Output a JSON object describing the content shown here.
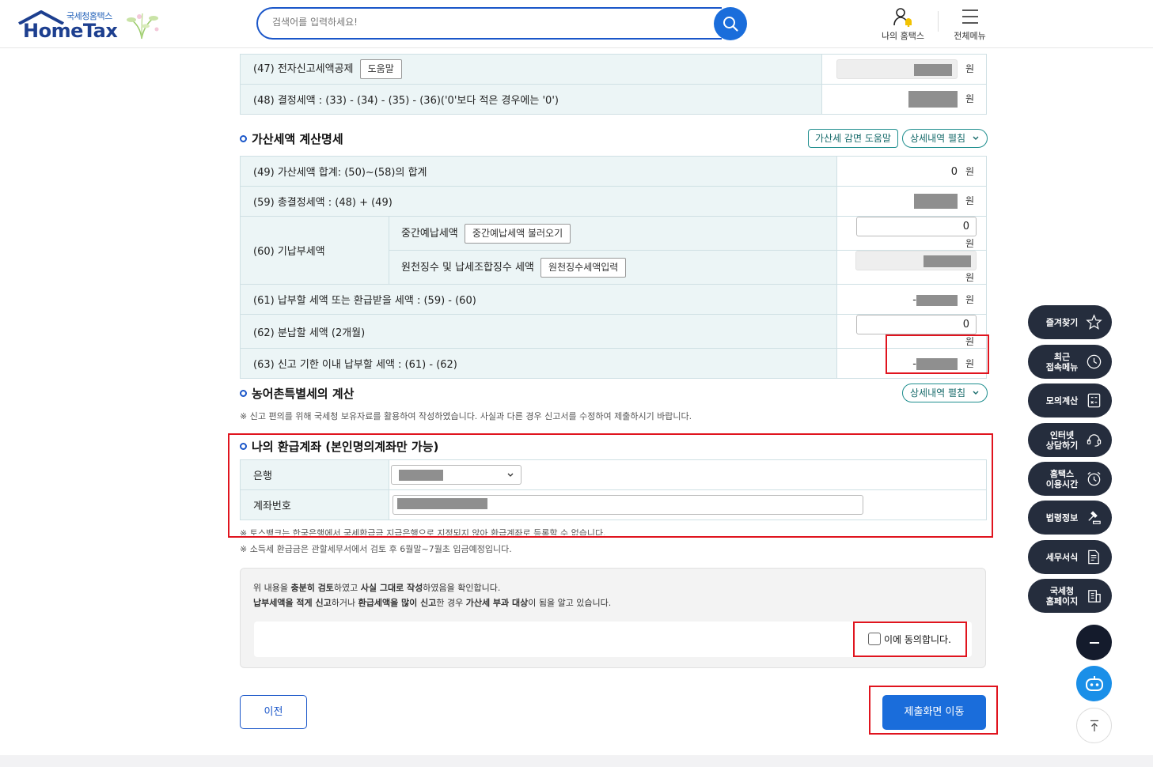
{
  "header": {
    "logo_sub": "국세청홈택스",
    "logo_main": "HomeTax",
    "search_placeholder": "검색어를 입력하세요!",
    "my_hometax": "나의 홈택스",
    "all_menu": "전체메뉴"
  },
  "top_rows": [
    {
      "label": "(47) 전자신고세액공제",
      "button": "도움말"
    },
    {
      "label": "(48) 결정세액 : (33) - (34) - (35) - (36)('0'보다 적은 경우에는 '0')"
    }
  ],
  "currency_unit": "원",
  "penalty": {
    "title": "가산세액 계산명세",
    "help_button": "가산세 감면 도움말",
    "expand_button": "상세내역 펼침",
    "row49": {
      "label": "(49) 가산세액 합계: (50)~(58)의 합계",
      "value": "0"
    },
    "row59": {
      "label": "(59) 총결정세액 : (48) + (49)"
    },
    "row60": {
      "label": "(60) 기납부세액",
      "sub1_label": "중간예납세액",
      "sub1_button": "중간예납세액 불러오기",
      "sub1_value": "0",
      "sub2_label": "원천징수 및 납세조합징수 세액",
      "sub2_button": "원천징수세액입력"
    },
    "row61": {
      "label": "(61) 납부할 세액 또는 환급받을 세액 : (59) - (60)",
      "sign": "-"
    },
    "row62": {
      "label": "(62) 분납할 세액 (2개월)",
      "value": "0"
    },
    "row63": {
      "label": "(63) 신고 기한 이내 납부할 세액 : (61) - (62)",
      "sign": "-"
    }
  },
  "rural": {
    "title": "농어촌특별세의 계산",
    "expand_button": "상세내역 펼침",
    "note": "※ 신고 편의를 위해 국세청 보유자료를 활용하여 작성하였습니다. 사실과 다른 경우 신고서를 수정하여 제출하시기 바랍니다."
  },
  "refund": {
    "title": "나의 환급계좌 (본인명의계좌만 가능)",
    "bank_label": "은행",
    "account_label": "계좌번호",
    "note1": "※ 토스뱅크는 한국은행에서 국세환급금 지급은행으로 지정되지 않아 환급계좌로 등록할 수 없습니다.",
    "note2": "※ 소득세 환급금은 관할세무서에서 검토 후 6월말~7월초 입금예정입니다."
  },
  "agreement": {
    "line1_a": "위 내용을 ",
    "line1_b": "충분히 검토",
    "line1_c": "하였고 ",
    "line1_d": "사실 그대로 작성",
    "line1_e": "하였음을 확인합니다.",
    "line2_a": "납부세액을 적게 신고",
    "line2_b": "하거나 ",
    "line2_c": "환급세액을 많이 신고",
    "line2_d": "한 경우 ",
    "line2_e": "가산세 부과 대상",
    "line2_f": "이 됨을 알고 있습니다.",
    "checkbox_label": "이에 동의합니다."
  },
  "buttons": {
    "prev": "이전",
    "submit": "제출화면 이동"
  },
  "quick_menu": [
    {
      "label": "즐겨찾기",
      "icon": "star-icon"
    },
    {
      "label": "최근\n접속메뉴",
      "icon": "clock-icon"
    },
    {
      "label": "모의계산",
      "icon": "calculator-icon"
    },
    {
      "label": "인터넷\n상담하기",
      "icon": "chat-icon"
    },
    {
      "label": "홈택스\n이용시간",
      "icon": "alarm-clock-icon"
    },
    {
      "label": "법령정보",
      "icon": "gavel-icon"
    },
    {
      "label": "세무서식",
      "icon": "document-icon"
    },
    {
      "label": "국세청\n홈페이지",
      "icon": "building-icon"
    }
  ],
  "colors": {
    "primary": "#1a6ddb",
    "highlight": "#e0141e",
    "teal": "#1e8e8e",
    "label_bg": "#ecf5f6"
  }
}
